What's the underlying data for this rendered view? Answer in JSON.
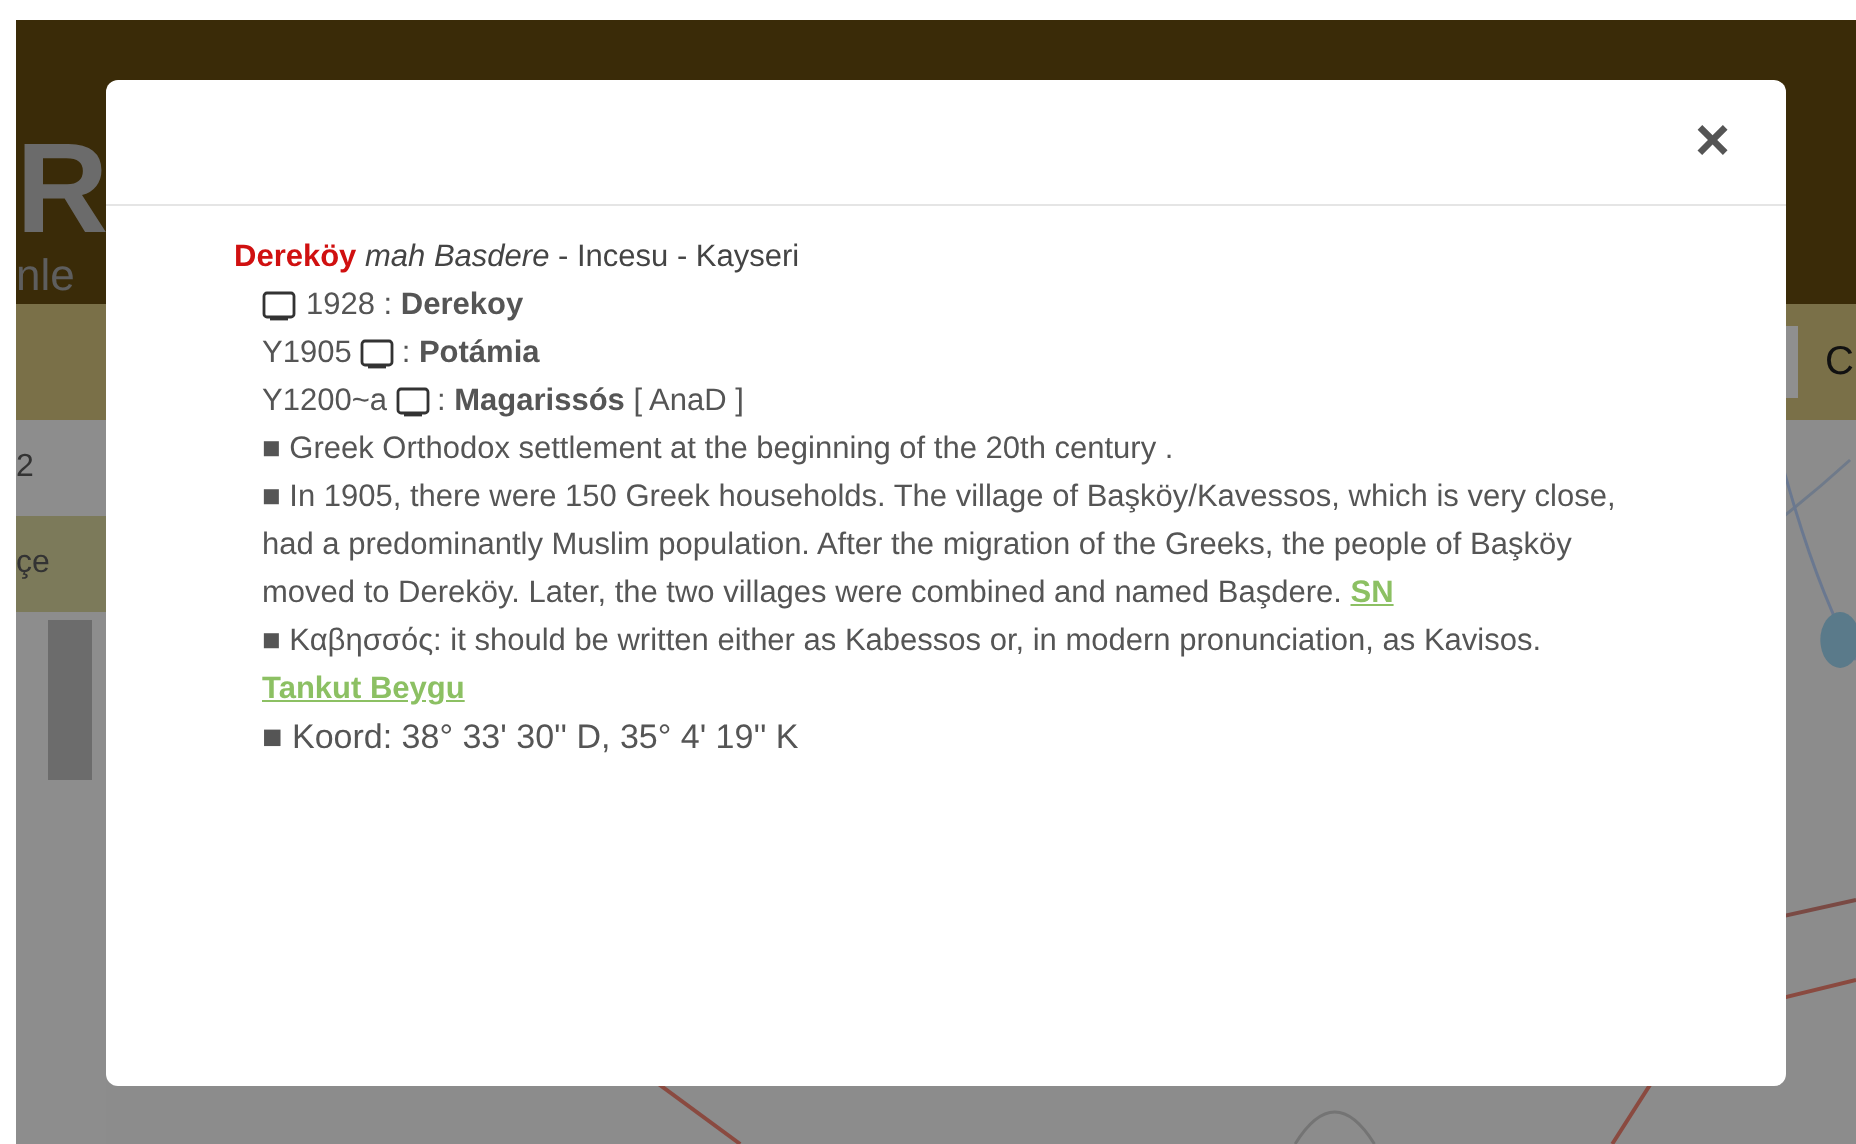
{
  "background": {
    "brand": "R",
    "tagline": "nle",
    "side_items": [
      {
        "label": "2",
        "selected": false
      },
      {
        "label": "çe",
        "selected": true
      }
    ],
    "search_button": "C"
  },
  "dialog": {
    "close": "×",
    "heading": "**Dereköy** *mah Basdere* - Incesu - Kayseri",
    "names": [
      {
        "kind": "icon_first",
        "text": "1928 : **Derekoy**"
      },
      {
        "kind": "icon_after",
        "lead": "Y1905",
        "text": ": **Potámia**"
      },
      {
        "kind": "icon_after",
        "lead": "Y1200~a",
        "text": ": **Magarissós** [ AnaD ]"
      }
    ],
    "notes": [
      {
        "kind": "plain",
        "text": "■ Greek Orthodox settlement at the beginning of the 20th century ."
      },
      {
        "kind": "plain",
        "text": "■ In 1905, there were 150 Greek households. The village of Başköy/Kavessos, which is very close, had a predominantly Muslim population. After the migration of the Greeks, the people of Başköy moved to Dereköy. Later, the two villages were combined and named Başdere.",
        "link": "SN"
      },
      {
        "kind": "plain",
        "text": "■ Καβησσός: it should be written either as Kabessos or, in modern pronunciation, as Kavisos.",
        "link": "Tankut Beygu"
      },
      {
        "kind": "coordinates",
        "text": "■ Koord: 38° 33' 30'' D, 35° 4' 19'' K"
      }
    ]
  }
}
